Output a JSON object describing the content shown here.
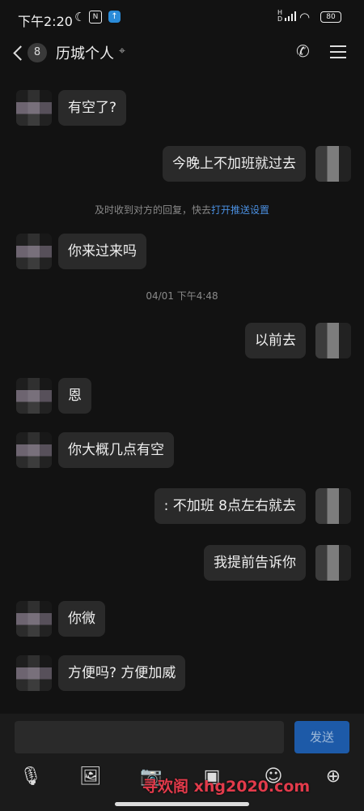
{
  "status_bar": {
    "time": "下午2:20",
    "battery": "80"
  },
  "header": {
    "unread_count": "8",
    "title": "历城个人"
  },
  "messages": [
    {
      "side": "left",
      "text": "有空了?"
    },
    {
      "side": "right",
      "text": "今晚上不加班就过去"
    },
    {
      "side": "left",
      "text": "你来过来吗"
    },
    {
      "side": "right",
      "text": "以前去"
    },
    {
      "side": "left",
      "text": "恩"
    },
    {
      "side": "left",
      "text": "你大概几点有空"
    },
    {
      "side": "right",
      "text": ": 不加班  8点左右就去"
    },
    {
      "side": "right",
      "text": "我提前告诉你"
    },
    {
      "side": "left",
      "text": "你微"
    },
    {
      "side": "left",
      "text": "方便吗? 方便加威"
    }
  ],
  "system_notice": {
    "text": "及时收到对方的回复，快去",
    "link": "打开",
    "link_tail": "推送设置"
  },
  "timestamp": "04/01 下午4:48",
  "input": {
    "send_label": "发送"
  },
  "toolbar_icons": [
    "microphone-icon",
    "image-icon",
    "camera-icon",
    "gif-icon",
    "emoji-icon",
    "plus-icon"
  ],
  "watermark": "寻欢阁 xhg2020.com",
  "colors": {
    "background": "#121212",
    "bubble": "#2a2a2a",
    "send_button": "#1d5aa8",
    "link": "#4a8fe0",
    "watermark": "#e23b4b"
  }
}
